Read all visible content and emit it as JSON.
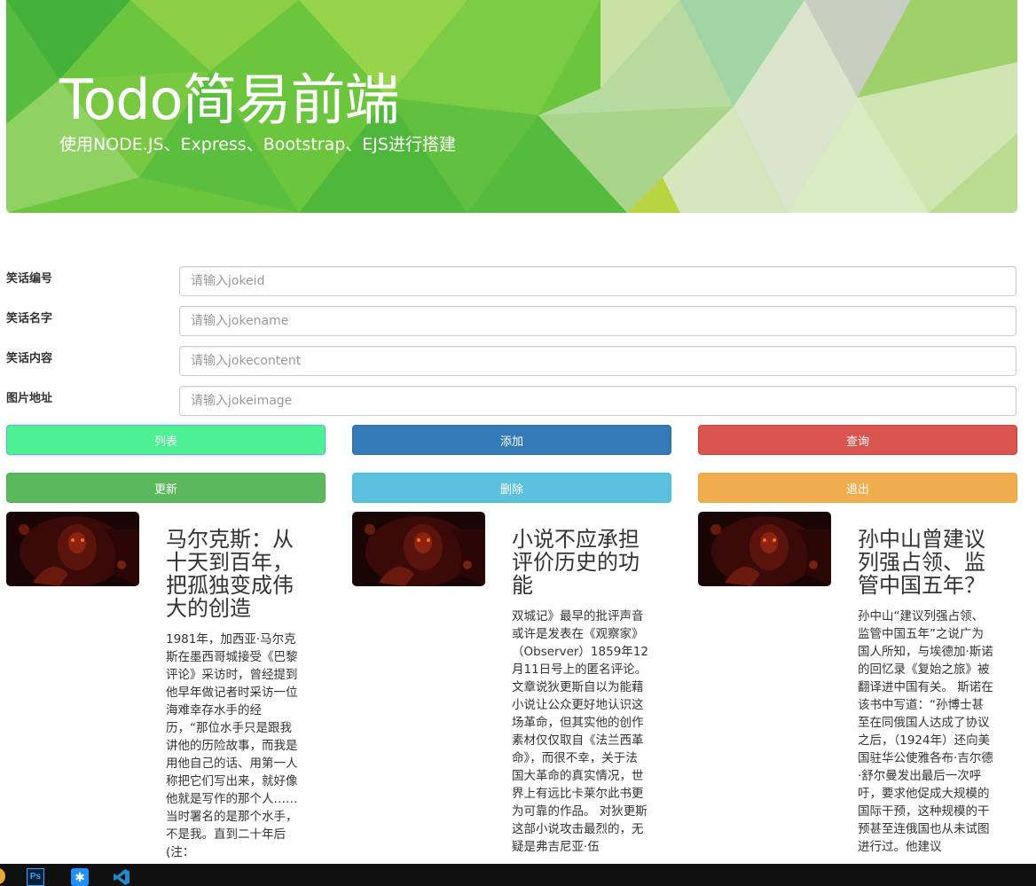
{
  "banner": {
    "title": "Todo简易前端",
    "subtitle": "使用NODE.JS、Express、Bootstrap、EJS进行搭建"
  },
  "form": {
    "fields": [
      {
        "label": "笑话编号",
        "placeholder": "请输入jokeid"
      },
      {
        "label": "笑话名字",
        "placeholder": "请输入jokename"
      },
      {
        "label": "笑话内容",
        "placeholder": "请输入jokecontent"
      },
      {
        "label": "图片地址",
        "placeholder": "请输入jokeimage"
      }
    ]
  },
  "buttons": {
    "list": "列表",
    "add": "添加",
    "query": "查询",
    "update": "更新",
    "delete": "删除",
    "exit": "退出"
  },
  "cards": [
    {
      "title": "马尔克斯：从十天到百年，把孤独变成伟大的创造",
      "text": "1981年，加西亚·马尔克斯在墨西哥城接受《巴黎评论》采访时，曾经提到他早年做记者时采访一位海难幸存水手的经历，“那位水手只是跟我讲他的历险故事，而我是用他自己的话、用第一人称把它们写出来，就好像他就是写作的那个人……当时署名的是那个水手，不是我。直到二十年后(注："
    },
    {
      "title": "小说不应承担评价历史的功能",
      "text": "双城记》最早的批评声音或许是发表在《观察家》（Observer）1859年12月11日号上的匿名评论。文章说狄更斯自以为能藉小说让公众更好地认识这场革命，但其实他的创作素材仅仅取自《法兰西革命》，而很不幸，关于法国大革命的真实情况，世界上有远比卡莱尔此书更为可靠的作品。 对狄更斯这部小说攻击最烈的，无疑是弗吉尼亚·伍"
    },
    {
      "title": "孙中山曾建议列强占领、监管中国五年？",
      "text": "孙中山“建议列强占领、监管中国五年”之说广为国人所知，与埃德加·斯诺的回忆录《复始之旅》被翻译进中国有关。 斯诺在该书中写道：“孙博士甚至在同俄国人达成了协议之后，（1924年）还向美国驻华公使雅各布·吉尔德·舒尔曼发出最后一次呼吁，要求他促成大规模的国际干预，这种规模的干预甚至连俄国也从未试图进行过。他建议"
    }
  ],
  "taskbar": {
    "ps_label": "Ps",
    "colors": {
      "ps": "#31a8ff",
      "star": "#1e90ff",
      "vs": "#2489ca"
    }
  },
  "colors": {
    "banner_green": "#6cc63d",
    "btn_list": "#4df093",
    "btn_add": "#337ab7",
    "btn_query": "#d9534f",
    "btn_update": "#5cb85c",
    "btn_delete": "#5bc0de",
    "btn_exit": "#f0ad4e"
  }
}
